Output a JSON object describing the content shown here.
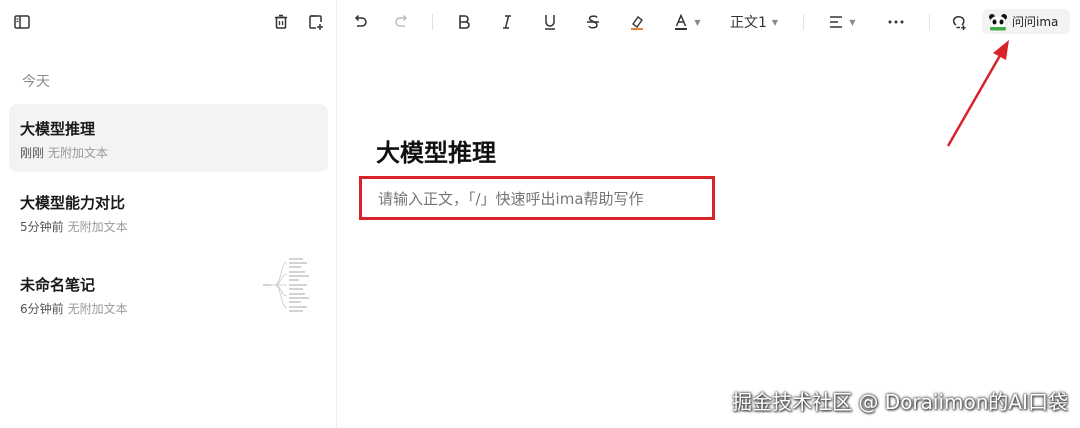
{
  "sidebar": {
    "section_today": "今天",
    "notes": [
      {
        "title": "大模型推理",
        "time": "刚刚",
        "subtitle": "无附加文本",
        "active": true
      },
      {
        "title": "大模型能力对比",
        "time": "5分钟前",
        "subtitle": "无附加文本",
        "active": false
      },
      {
        "title": "未命名笔记",
        "time": "6分钟前",
        "subtitle": "无附加文本",
        "active": false
      }
    ],
    "icons": [
      "sidebar-toggle-icon",
      "trash-icon",
      "new-note-icon"
    ]
  },
  "toolbar": {
    "paragraph_style": "正文1",
    "ask_button_label": "问问ima",
    "icons": [
      "undo-icon",
      "redo-icon",
      "bold-icon",
      "italic-icon",
      "underline-icon",
      "strikethrough-icon",
      "highlight-icon",
      "font-color-icon",
      "align-icon",
      "more-icon",
      "bulb-icon",
      "panda-icon"
    ],
    "highlight_color": "#e8833a"
  },
  "editor": {
    "title": "大模型推理",
    "body_placeholder": "请输入正文，「/」快速呼出ima帮助写作"
  },
  "annotation_color": "#d9232b",
  "watermark": "掘金技术社区 @ Doraiimon的AI口袋"
}
